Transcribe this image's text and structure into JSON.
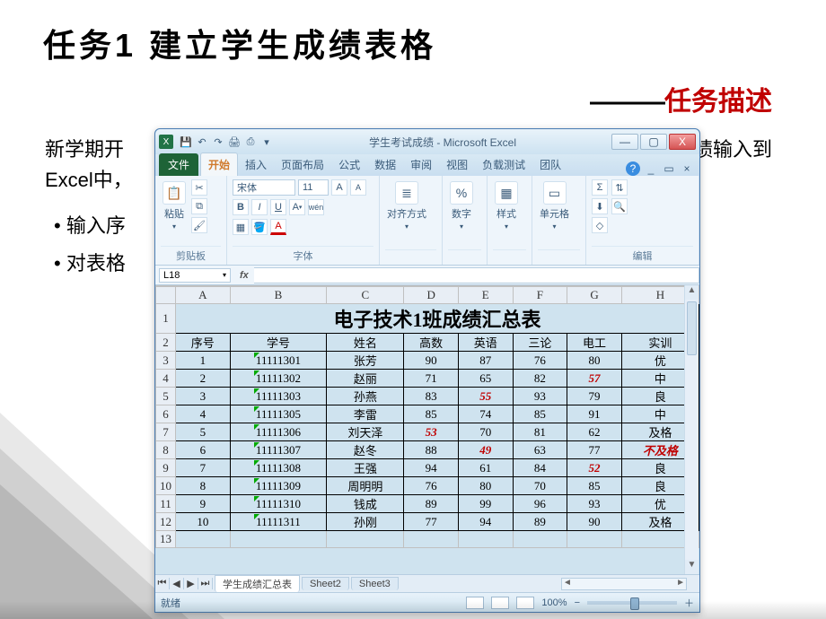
{
  "slide": {
    "title": "任务1  建立学生成绩表格",
    "subtitle_dash": "———",
    "subtitle": "任务描述",
    "body_line1": "新学期开",
    "body_line1_tail": "的成绩输入到",
    "body_line2": "Excel中，",
    "body_line2_tail": "：",
    "bullet1": "输入序",
    "bullet2": "对表格"
  },
  "excel": {
    "app_icon_letter": "X",
    "qat": [
      "💾",
      "↶",
      "↷",
      "🖨",
      "⎙",
      "▾"
    ],
    "window_title": "学生考试成绩 - Microsoft Excel",
    "win_controls": {
      "min": "—",
      "max": "▢",
      "close": "X"
    },
    "ribbon_tabs": {
      "file": "文件",
      "tabs": [
        "开始",
        "插入",
        "页面布局",
        "公式",
        "数据",
        "审阅",
        "视图",
        "负载测试",
        "团队"
      ],
      "active": "开始",
      "help": "?"
    },
    "mdi_controls": {
      "min": "_",
      "restore": "▭",
      "close": "×"
    },
    "ribbon": {
      "clipboard": {
        "label": "剪贴板",
        "paste": "粘贴",
        "paste_icon": "📋",
        "cut": "✂",
        "copy": "⧉",
        "fmt": "🖌"
      },
      "font": {
        "label": "字体",
        "name": "宋体",
        "size": "11",
        "bold": "B",
        "italic": "I",
        "underline": "U",
        "grow": "A",
        "shrink": "A",
        "border": "▦",
        "fill": "🪣",
        "color": "A"
      },
      "align": {
        "label": "对齐方式",
        "icon": "≣"
      },
      "number": {
        "label": "数字",
        "icon": "%"
      },
      "styles": {
        "label": "样式",
        "icon": "▦"
      },
      "cells": {
        "label": "单元格",
        "icon": "▭"
      },
      "editing": {
        "label": "编辑",
        "sigma": "Σ",
        "fill": "⬇",
        "clear": "◇",
        "sort": "⇅",
        "find": "🔍"
      }
    },
    "namebox": "L18",
    "fx": "fx",
    "columns": [
      "A",
      "B",
      "C",
      "D",
      "E",
      "F",
      "G",
      "H"
    ],
    "title_row": "电子技术1班成绩汇总表",
    "headers": [
      "序号",
      "学号",
      "姓名",
      "高数",
      "英语",
      "三论",
      "电工",
      "实训"
    ],
    "rows": [
      {
        "n": "1",
        "id": "11111301",
        "name": "张芳",
        "c1": "90",
        "c2": "87",
        "c3": "76",
        "c4": "80",
        "r": "优"
      },
      {
        "n": "2",
        "id": "11111302",
        "name": "赵丽",
        "c1": "71",
        "c2": "65",
        "c3": "82",
        "c4": "57",
        "r": "中",
        "f": [
          "c4"
        ]
      },
      {
        "n": "3",
        "id": "11111303",
        "name": "孙燕",
        "c1": "83",
        "c2": "55",
        "c3": "93",
        "c4": "79",
        "r": "良",
        "f": [
          "c2"
        ]
      },
      {
        "n": "4",
        "id": "11111305",
        "name": "李雷",
        "c1": "85",
        "c2": "74",
        "c3": "85",
        "c4": "91",
        "r": "中"
      },
      {
        "n": "5",
        "id": "11111306",
        "name": "刘天泽",
        "c1": "53",
        "c2": "70",
        "c3": "81",
        "c4": "62",
        "r": "及格",
        "f": [
          "c1"
        ]
      },
      {
        "n": "6",
        "id": "11111307",
        "name": "赵冬",
        "c1": "88",
        "c2": "49",
        "c3": "63",
        "c4": "77",
        "r": "不及格",
        "f": [
          "c2",
          "r"
        ]
      },
      {
        "n": "7",
        "id": "11111308",
        "name": "王强",
        "c1": "94",
        "c2": "61",
        "c3": "84",
        "c4": "52",
        "r": "良",
        "f": [
          "c4"
        ]
      },
      {
        "n": "8",
        "id": "11111309",
        "name": "周明明",
        "c1": "76",
        "c2": "80",
        "c3": "70",
        "c4": "85",
        "r": "良"
      },
      {
        "n": "9",
        "id": "11111310",
        "name": "钱成",
        "c1": "89",
        "c2": "99",
        "c3": "96",
        "c4": "93",
        "r": "优"
      },
      {
        "n": "10",
        "id": "11111311",
        "name": "孙刚",
        "c1": "77",
        "c2": "94",
        "c3": "89",
        "c4": "90",
        "r": "及格"
      }
    ],
    "sheet_tabs": {
      "nav": [
        "⏮",
        "◀",
        "▶",
        "⏭"
      ],
      "tabs": [
        "学生成绩汇总表",
        "Sheet2",
        "Sheet3"
      ],
      "active": "学生成绩汇总表"
    },
    "status": {
      "ready": "就绪",
      "views": [
        "▦",
        "▤",
        "▭"
      ],
      "zoom": "100%",
      "minus": "−",
      "plus": "＋"
    }
  }
}
